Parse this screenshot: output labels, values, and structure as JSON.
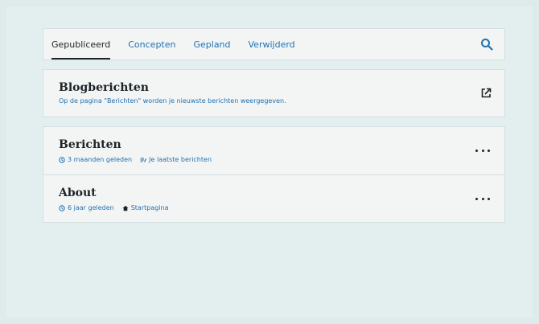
{
  "tabs": [
    {
      "label": "Gepubliceerd",
      "active": true
    },
    {
      "label": "Concepten",
      "active": false
    },
    {
      "label": "Gepland",
      "active": false
    },
    {
      "label": "Verwijderd",
      "active": false
    }
  ],
  "search": {
    "icon": "search-icon"
  },
  "blog": {
    "title": "Blogberichten",
    "description": "Op de pagina \"Berichten\" worden je nieuwste berichten weergegeven.",
    "icon": "external-link-icon"
  },
  "posts": [
    {
      "title": "Berichten",
      "time": "3 maanden geleden",
      "tag": "Je laatste berichten",
      "tag_icon": "posts-icon"
    },
    {
      "title": "About",
      "time": "6 jaar geleden",
      "tag": "Startpagina",
      "tag_icon": "home-icon"
    }
  ],
  "colors": {
    "accent": "#2271b1",
    "text": "#1d2327",
    "card": "#f3f5f5",
    "background": "#dfeaeb"
  }
}
